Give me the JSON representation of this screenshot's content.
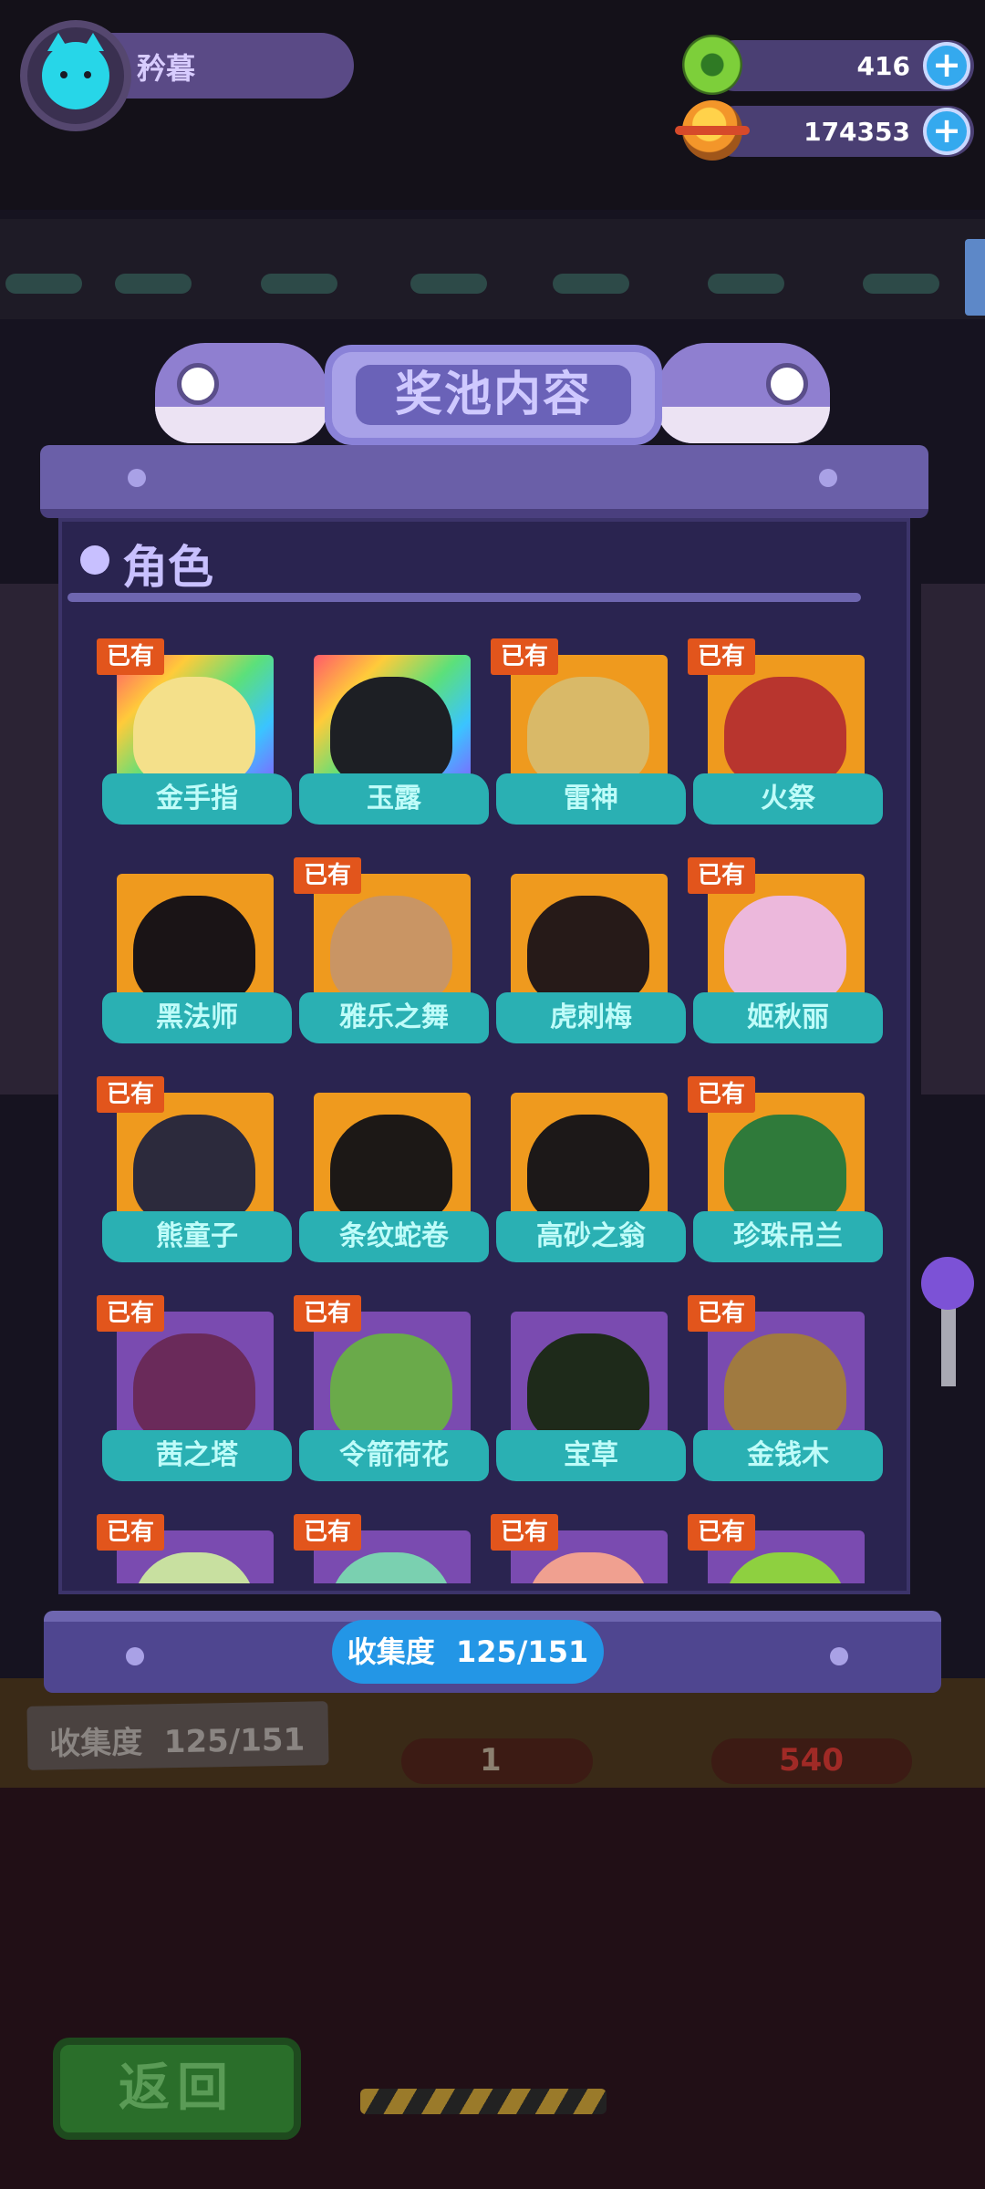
{
  "player": {
    "name": "矜暮"
  },
  "currencies": [
    {
      "icon": "green-donut-coin-icon",
      "value": "416"
    },
    {
      "icon": "orange-planet-coin-icon",
      "value": "174353"
    }
  ],
  "pool": {
    "title": "奖池内容",
    "section": "角色",
    "owned_label": "已有",
    "collection_label": "收集度",
    "collection_value": "125/151",
    "characters": [
      {
        "name": "金手指",
        "owned": true,
        "bg": "rainbow",
        "color": "#f4e08a"
      },
      {
        "name": "玉露",
        "owned": false,
        "bg": "rainbow",
        "color": "#1d1f24"
      },
      {
        "name": "雷神",
        "owned": true,
        "bg": "orange",
        "color": "#d9b968"
      },
      {
        "name": "火祭",
        "owned": true,
        "bg": "orange",
        "color": "#b8352e"
      },
      {
        "name": "黑法师",
        "owned": false,
        "bg": "orange",
        "color": "#1a1416"
      },
      {
        "name": "雅乐之舞",
        "owned": true,
        "bg": "orange",
        "color": "#c99564"
      },
      {
        "name": "虎刺梅",
        "owned": false,
        "bg": "orange",
        "color": "#261a18"
      },
      {
        "name": "姬秋丽",
        "owned": true,
        "bg": "orange",
        "color": "#ecb8dc"
      },
      {
        "name": "熊童子",
        "owned": true,
        "bg": "orange",
        "color": "#2c2a3c"
      },
      {
        "name": "条纹蛇卷",
        "owned": false,
        "bg": "orange",
        "color": "#1c1816"
      },
      {
        "name": "高砂之翁",
        "owned": false,
        "bg": "orange",
        "color": "#1c1818"
      },
      {
        "name": "珍珠吊兰",
        "owned": true,
        "bg": "orange",
        "color": "#2f7a3a"
      },
      {
        "name": "茜之塔",
        "owned": true,
        "bg": "purple",
        "color": "#6a2a5a"
      },
      {
        "name": "令箭荷花",
        "owned": true,
        "bg": "purple",
        "color": "#6aaa4a"
      },
      {
        "name": "宝草",
        "owned": false,
        "bg": "purple",
        "color": "#1e2a1a"
      },
      {
        "name": "金钱木",
        "owned": true,
        "bg": "purple",
        "color": "#a07a40"
      },
      {
        "name": "",
        "owned": true,
        "bg": "purple",
        "color": "#c8e0a0"
      },
      {
        "name": "",
        "owned": true,
        "bg": "purple",
        "color": "#7ad0b0"
      },
      {
        "name": "",
        "owned": true,
        "bg": "purple",
        "color": "#f0a090"
      },
      {
        "name": "",
        "owned": true,
        "bg": "purple",
        "color": "#8ed040"
      }
    ]
  },
  "background": {
    "collection_label": "收集度",
    "collection_value": "125/151",
    "left_count": "1",
    "right_price": "540",
    "back_button": "返回"
  }
}
